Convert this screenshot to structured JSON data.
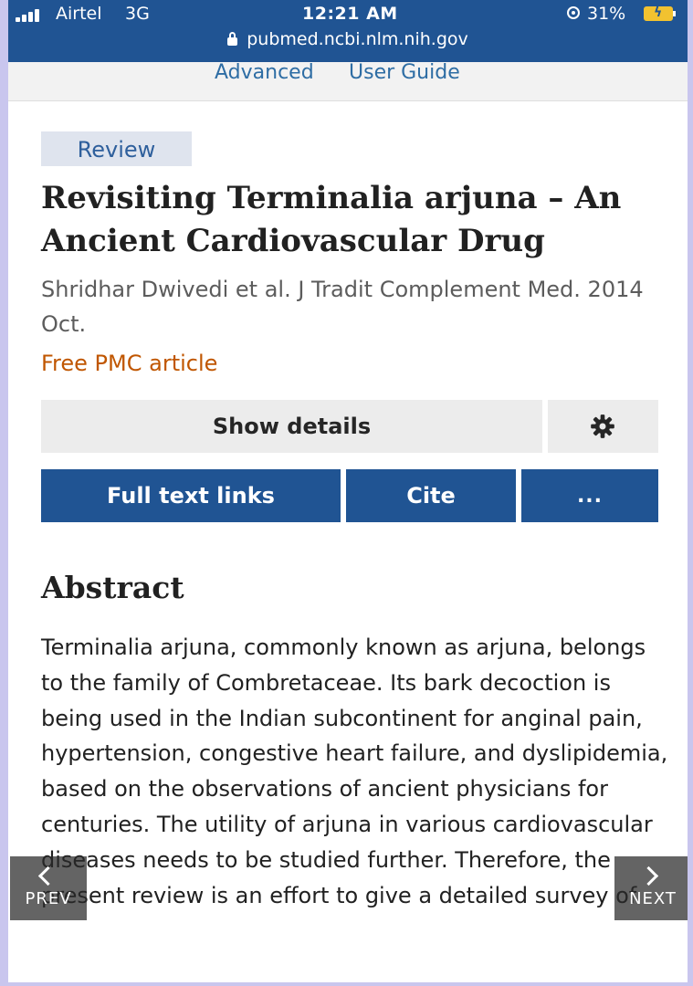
{
  "status_bar": {
    "carrier": "Airtel",
    "network": "3G",
    "time": "12:21 AM",
    "battery_percent": "31%",
    "icons": [
      "signal-bars-icon",
      "orientation-lock-icon",
      "battery-charging-icon"
    ]
  },
  "browser": {
    "url": "pubmed.ncbi.nlm.nih.gov"
  },
  "search_links": {
    "advanced": "Advanced",
    "user_guide": "User Guide"
  },
  "article": {
    "type_badge": "Review",
    "title": "Revisiting Terminalia arjuna – An Ancient Cardiovascular Drug",
    "citation": "Shridhar Dwivedi et al. J Tradit Complement Med. 2014 Oct.",
    "free_article_link": "Free PMC article"
  },
  "actions": {
    "show_details": "Show details",
    "settings_icon": "gear-icon",
    "full_text_links": "Full text links",
    "cite": "Cite",
    "more": "..."
  },
  "abstract": {
    "heading": "Abstract",
    "text": "Terminalia arjuna, commonly known as arjuna, belongs to the family of Combretaceae. Its bark decoction is being used in the Indian subcontinent for anginal pain, hypertension, congestive heart failure, and dyslipidemia, based on the observations of ancient physicians for centuries. The utility of arjuna in various cardiovascular diseases needs to be studied further. Therefore, the present review is an effort to give a detailed survey of"
  },
  "navigation": {
    "prev": "PREV",
    "next": "NEXT"
  },
  "colors": {
    "brand_blue": "#205493",
    "link_blue": "#2e6da4",
    "pmc_orange": "#c05600",
    "badge_bg": "#dfe4ee"
  }
}
